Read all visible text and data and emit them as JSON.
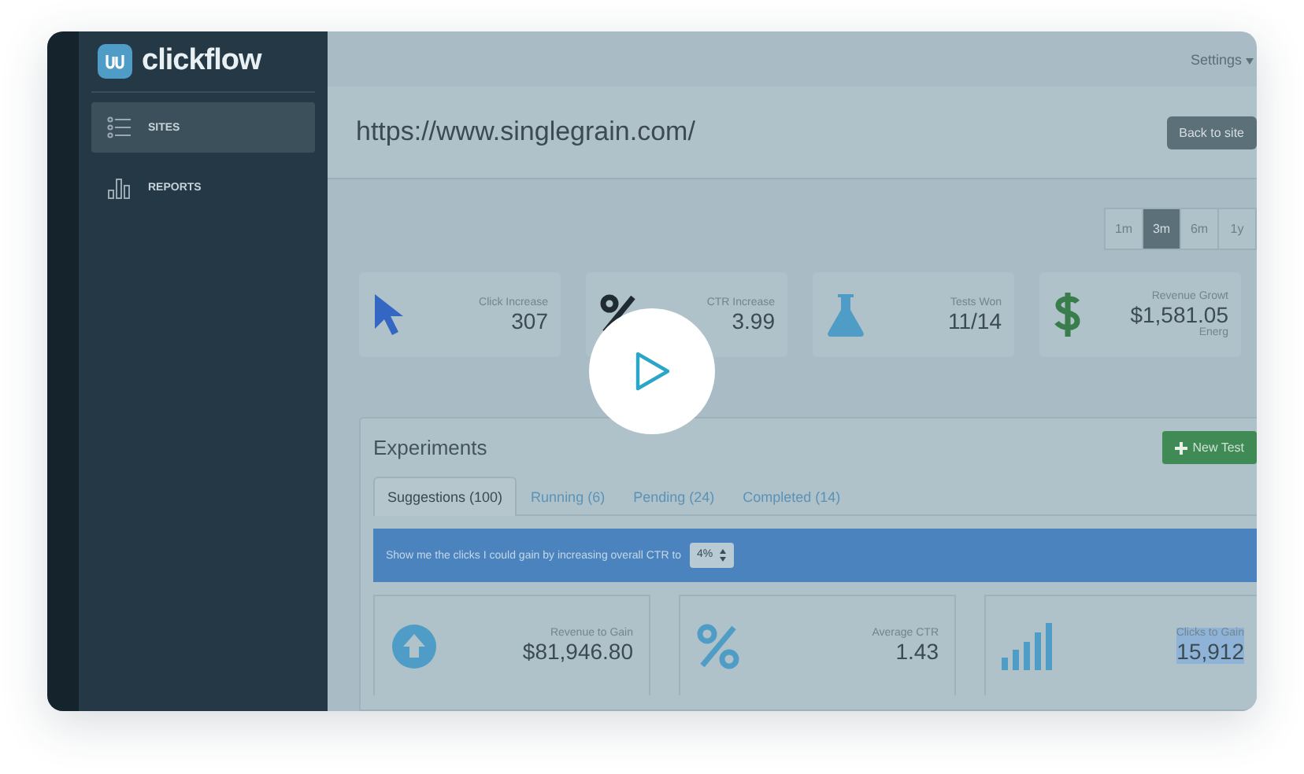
{
  "logo": {
    "text": "clickflow"
  },
  "sidebar": {
    "items": [
      {
        "label": "SITES",
        "kind": "list",
        "selected": true
      },
      {
        "label": "REPORTS",
        "kind": "chart",
        "selected": false
      }
    ]
  },
  "topbar": {
    "settings": "Settings"
  },
  "site": {
    "url": "https://www.singlegrain.com/",
    "back_button": "Back to site"
  },
  "ranges": [
    {
      "label": "1m",
      "selected": false
    },
    {
      "label": "3m",
      "selected": true
    },
    {
      "label": "6m",
      "selected": false
    },
    {
      "label": "1y",
      "selected": false
    }
  ],
  "stats": [
    {
      "kind": "cursor",
      "label": "Click Increase",
      "value": "307"
    },
    {
      "kind": "percent",
      "label": "CTR Increase",
      "value": "3.99"
    },
    {
      "kind": "flask",
      "label": "Tests Won",
      "value": "11/14"
    },
    {
      "kind": "dollar",
      "label": "Revenue Growt",
      "value": "$1,581.05",
      "note": "Energ"
    }
  ],
  "experiments": {
    "title": "Experiments",
    "new_button": "New Test",
    "tabs": [
      {
        "label": "Suggestions (100)",
        "selected": true
      },
      {
        "label": "Running (6)",
        "selected": false
      },
      {
        "label": "Pending (24)",
        "selected": false
      },
      {
        "label": "Completed (14)",
        "selected": false
      }
    ],
    "banner": {
      "text": "Show me the clicks I could gain by increasing overall CTR to",
      "select": "4%"
    },
    "metrics": [
      {
        "kind": "up",
        "label": "Revenue to Gain",
        "value": "$81,946.80",
        "highlighted": false
      },
      {
        "kind": "percent",
        "label": "Average CTR",
        "value": "1.43",
        "highlighted": false
      },
      {
        "kind": "bars",
        "label": "Clicks to Gain",
        "value": "15,912",
        "highlighted": true
      }
    ]
  },
  "video": {
    "playing": false
  }
}
